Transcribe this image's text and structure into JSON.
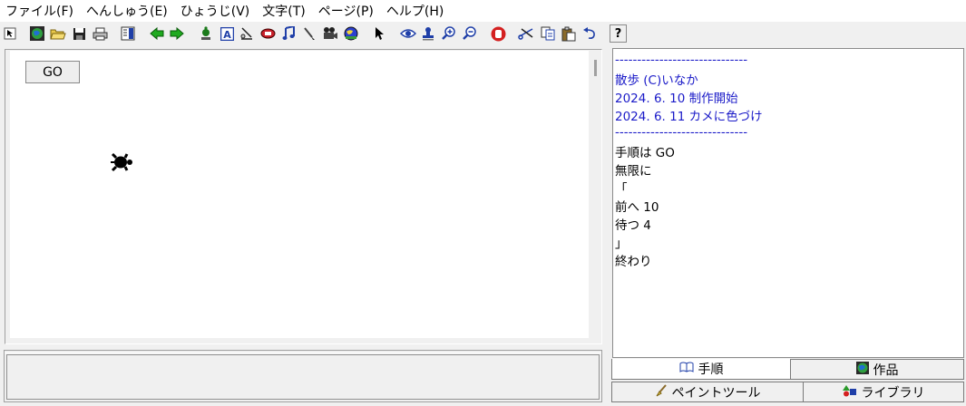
{
  "menu": [
    "ファイル(F)",
    "へんしゅう(E)",
    "ひょうじ(V)",
    "文字(T)",
    "ページ(P)",
    "ヘルプ(H)"
  ],
  "toolbar": {
    "icons": [
      "pointer-arrow-icon",
      "globe-icon",
      "open-folder-icon",
      "save-disk-icon",
      "print-icon",
      "page-layout-icon",
      "back-arrow-icon",
      "forward-arrow-icon",
      "turtle-stamp-icon",
      "text-tool-icon",
      "line-tool-icon",
      "shape-tool-icon",
      "music-note-icon",
      "brush-tool-icon",
      "video-camera-icon",
      "world-icon",
      "select-cursor-icon",
      "eye-icon",
      "stamp-icon",
      "zoom-in-icon",
      "zoom-out-icon",
      "stop-hand-icon",
      "cut-scissors-icon",
      "copy-icon",
      "paste-icon",
      "undo-icon"
    ],
    "help_label": "?"
  },
  "canvas": {
    "go_button_label": "GO"
  },
  "code": {
    "lines": [
      "------------------------------",
      "散歩 (C)いなか",
      "2024. 6. 10 制作開始",
      "2024. 6. 11 カメに色づけ",
      "------------------------------",
      "手順は GO",
      "無限に",
      "「",
      "前へ 10",
      "待つ 4",
      "」",
      "終わり"
    ]
  },
  "tabs": {
    "procedures": "手順",
    "works": "作品",
    "paint_tool": "ペイントツール",
    "library": "ライブラリ"
  },
  "colors": {
    "header_text": "#1a1ac8",
    "turtle": "#000000"
  }
}
